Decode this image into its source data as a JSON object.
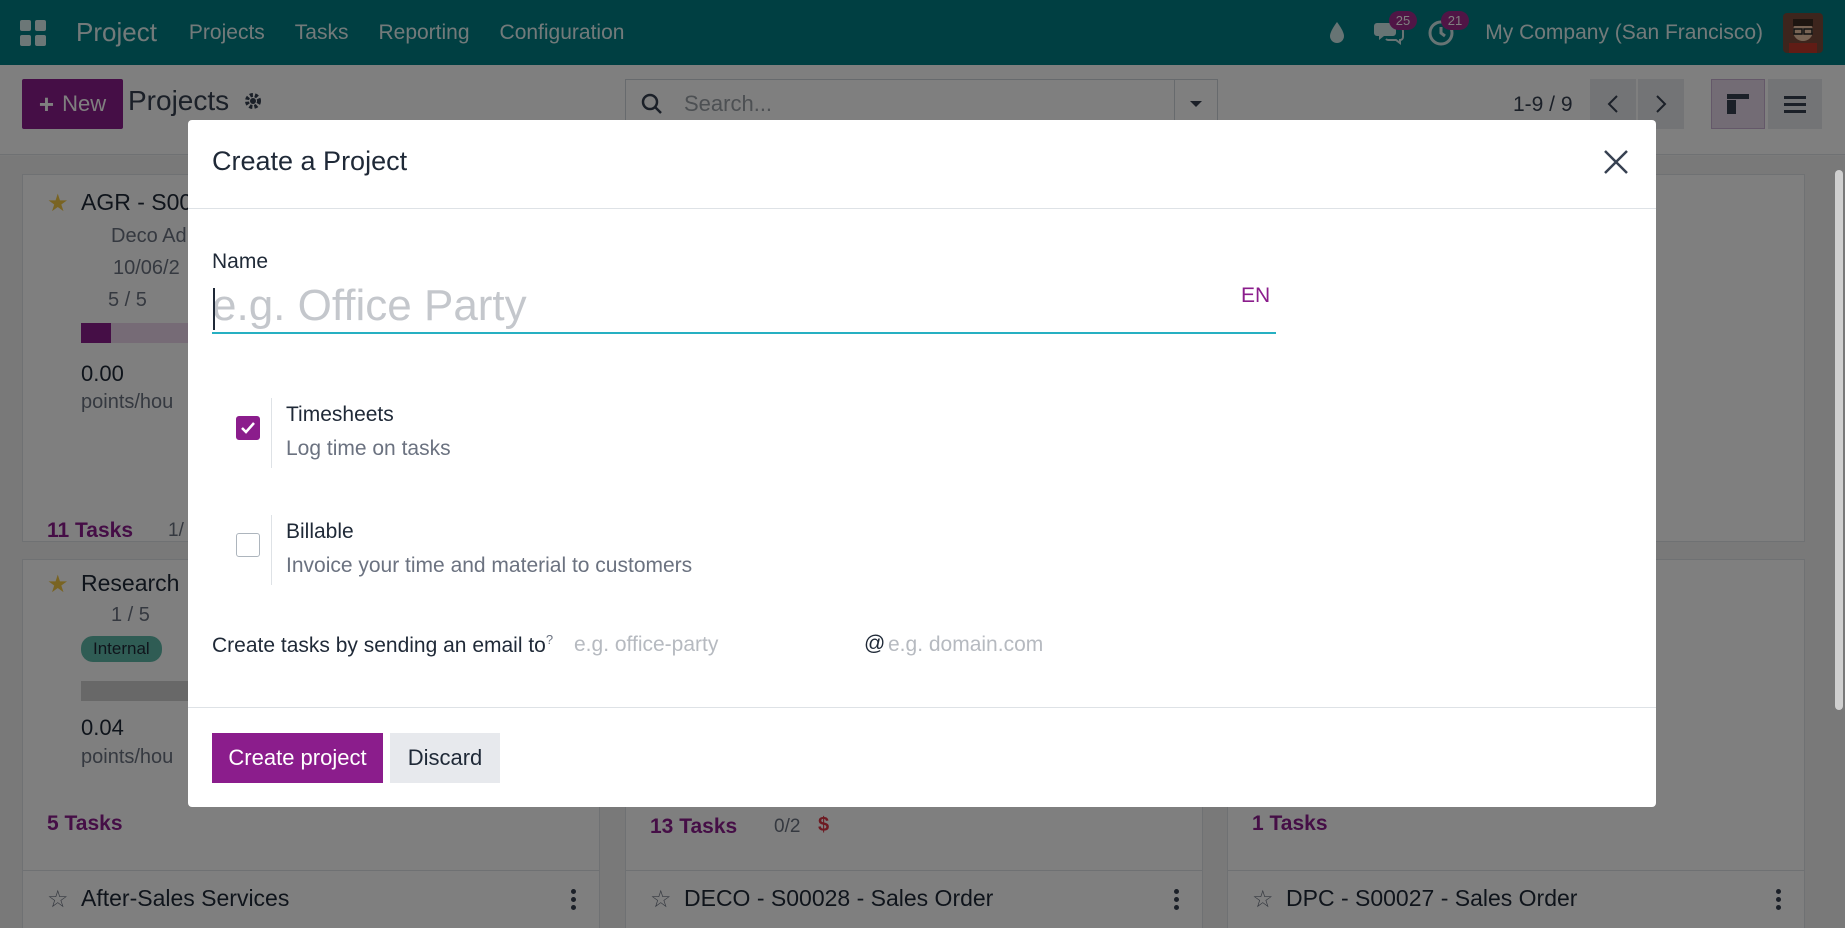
{
  "navbar": {
    "app_name": "Project",
    "menu": [
      "Projects",
      "Tasks",
      "Reporting",
      "Configuration"
    ],
    "messages_count": "25",
    "activities_count": "21",
    "company": "My Company (San Francisco)"
  },
  "control": {
    "new_label": "New",
    "breadcrumb": "Projects",
    "search_placeholder": "Search...",
    "pager": "1-9 / 9"
  },
  "kanban": {
    "cards": [
      {
        "title": "AGR - S00",
        "customer": "Deco Ad",
        "date": "10/06/2",
        "rating": "5 / 5",
        "value": "0.00",
        "unit": "points/hou",
        "tasks": "11 Tasks",
        "milestone": "1/"
      },
      {
        "title": "Research",
        "rating": "1 / 5",
        "tag": "Internal",
        "value": "0.04",
        "unit": "points/hou",
        "tasks": "5 Tasks"
      },
      {
        "tasks": "13 Tasks",
        "milestone": "0/2",
        "currency": "$"
      },
      {
        "tasks": "1 Tasks"
      },
      {
        "title": "After-Sales Services"
      },
      {
        "title": "DECO - S00028 - Sales Order"
      },
      {
        "title": "DPC - S00027 - Sales Order"
      }
    ]
  },
  "modal": {
    "title": "Create a Project",
    "name_label": "Name",
    "name_placeholder": "e.g. Office Party",
    "lang": "EN",
    "timesheets": {
      "title": "Timesheets",
      "desc": "Log time on tasks",
      "checked": true
    },
    "billable": {
      "title": "Billable",
      "desc": "Invoice your time and material to customers",
      "checked": false
    },
    "email_label": "Create tasks by sending an email to",
    "email_help": "?",
    "alias_placeholder": "e.g. office-party",
    "at": "@",
    "domain_placeholder": "e.g. domain.com",
    "create_label": "Create project",
    "discard_label": "Discard"
  },
  "colors": {
    "navbar": "#017e84",
    "primary": "#8b1d8c",
    "focus": "#26b0c2"
  }
}
